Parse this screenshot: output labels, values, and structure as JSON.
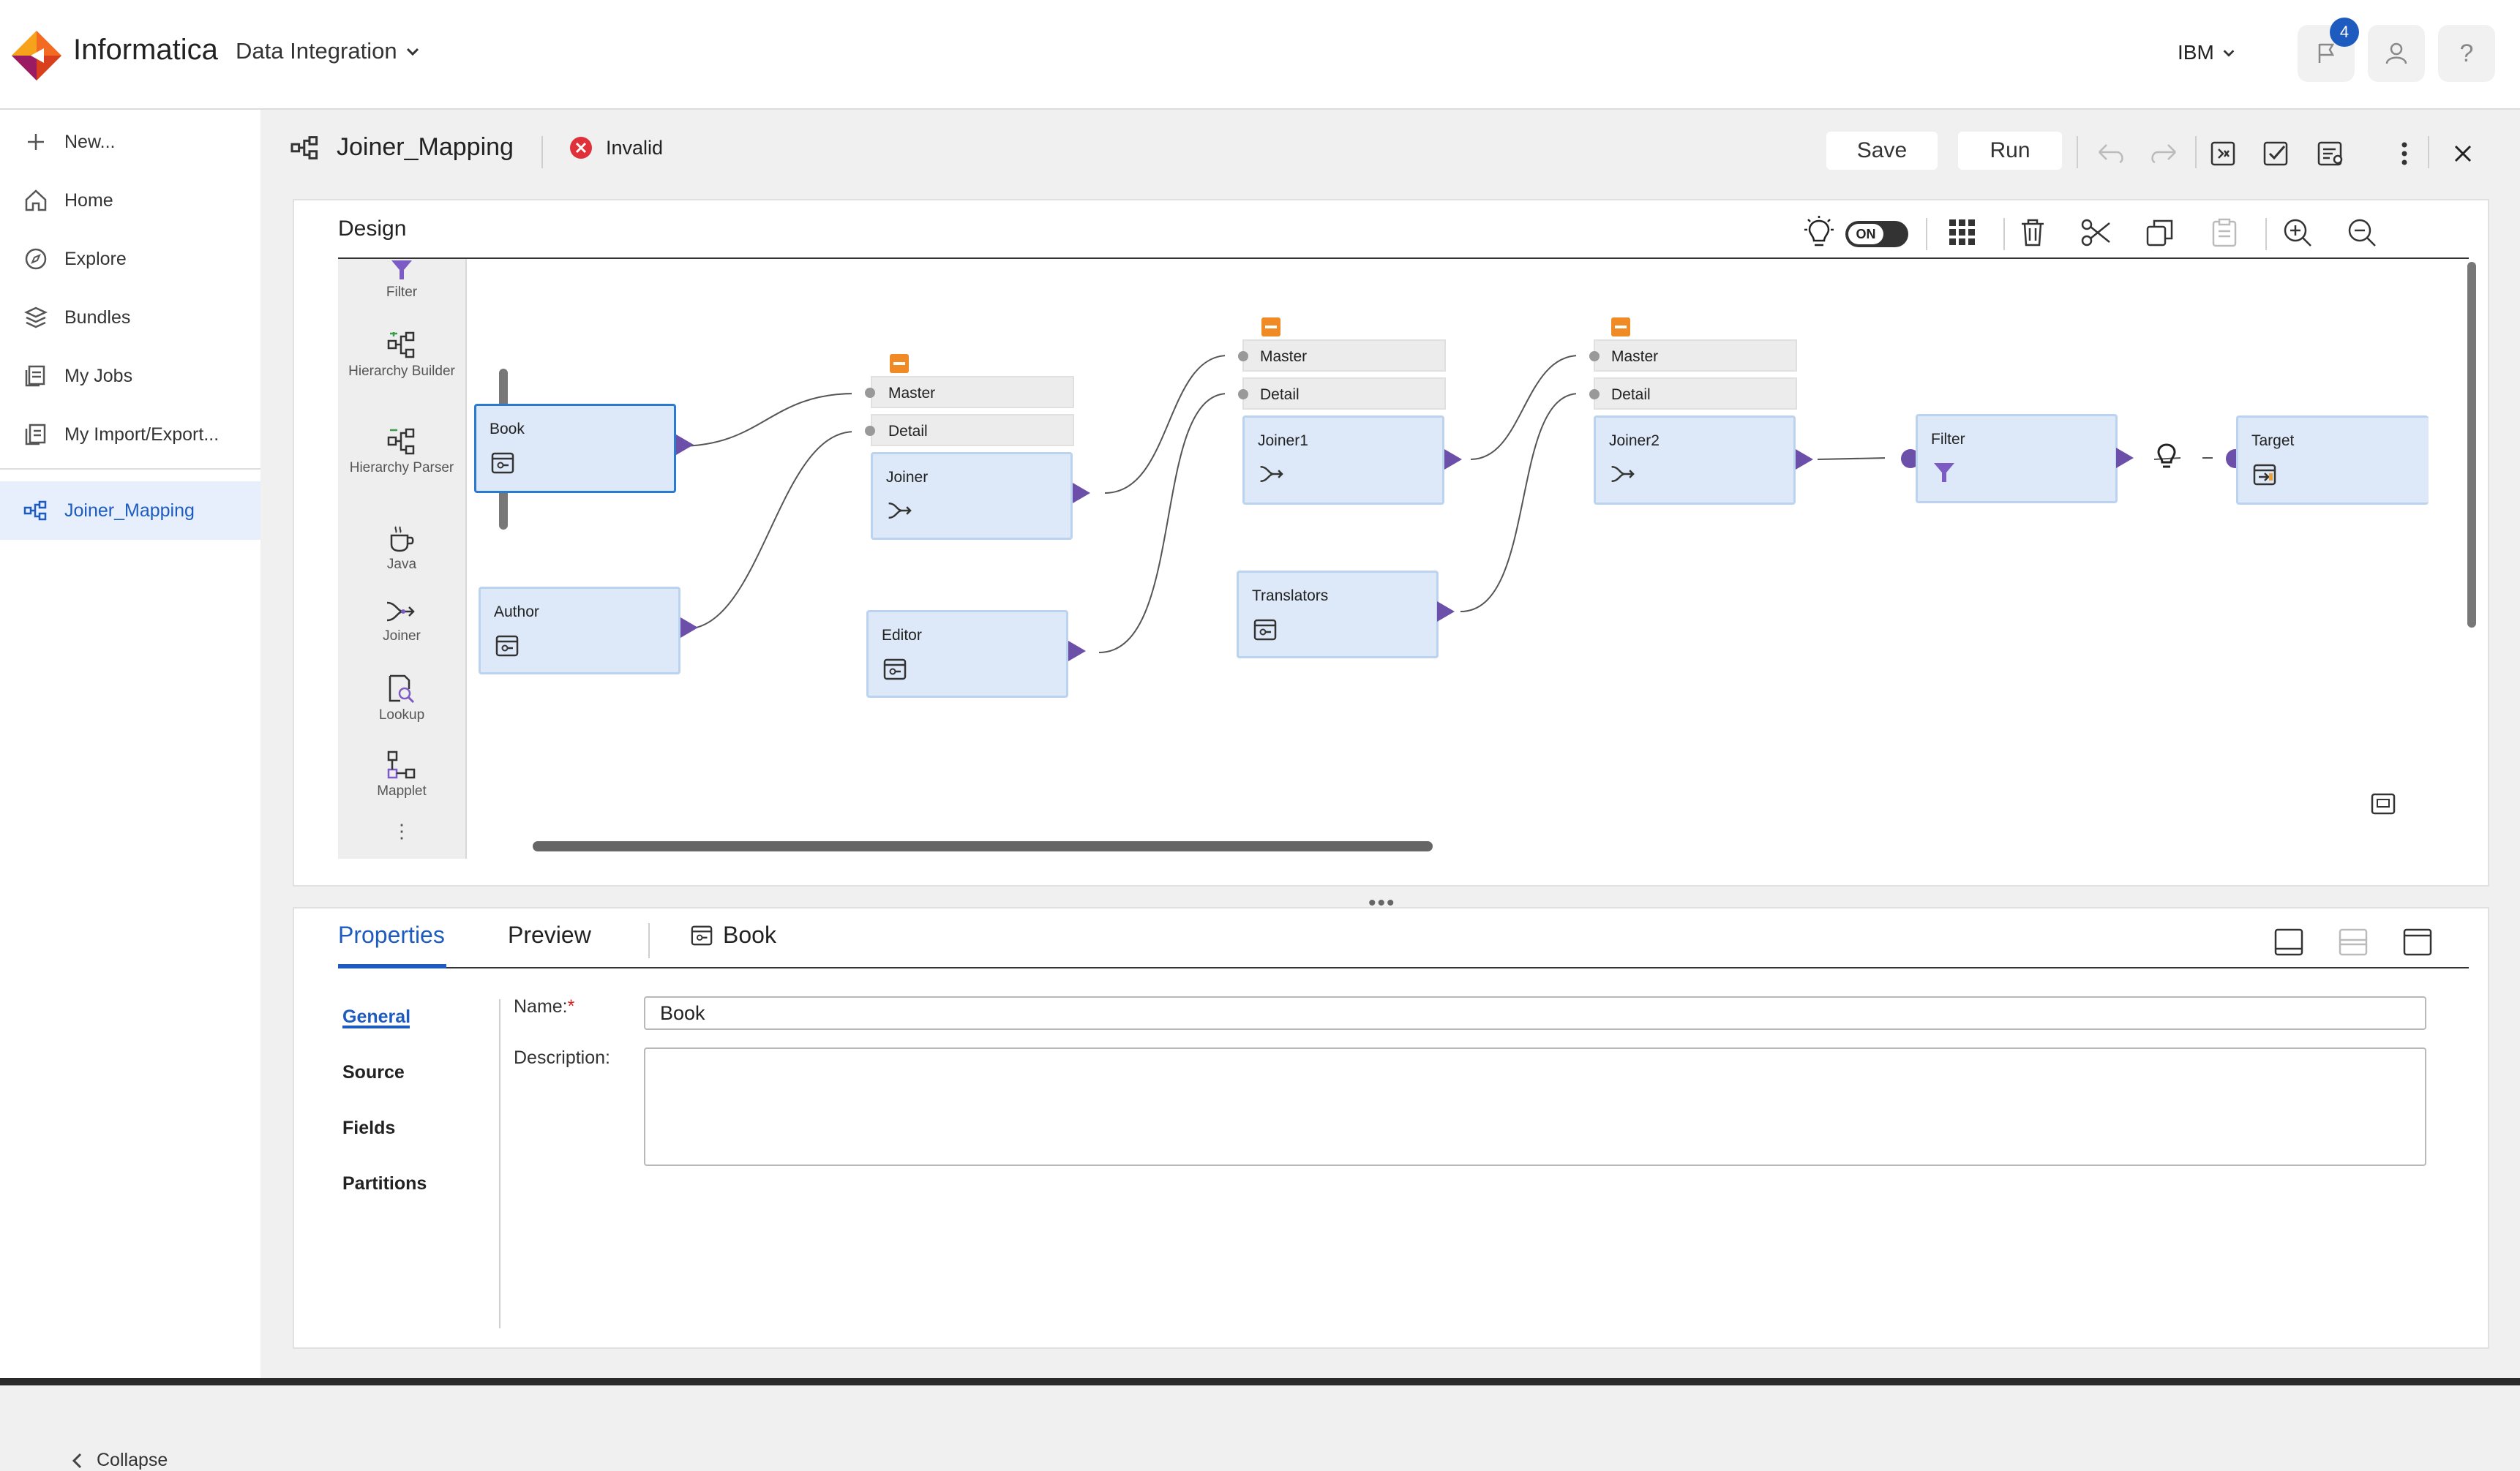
{
  "app": {
    "brand": "Informatica",
    "product": "Data Integration",
    "org": "IBM",
    "notification_count": "4",
    "help_glyph": "?"
  },
  "nav": {
    "new_label": "New...",
    "items": [
      {
        "label": "Home",
        "icon": "home-icon"
      },
      {
        "label": "Explore",
        "icon": "compass-icon"
      },
      {
        "label": "Bundles",
        "icon": "cube-stack-icon"
      },
      {
        "label": "My Jobs",
        "icon": "jobs-icon"
      },
      {
        "label": "My Import/Export...",
        "icon": "import-export-icon"
      }
    ],
    "open_asset": "Joiner_Mapping",
    "collapse_label": "Collapse"
  },
  "header": {
    "title": "Joiner_Mapping",
    "status": "Invalid",
    "save_label": "Save",
    "run_label": "Run"
  },
  "design": {
    "title": "Design",
    "toggle_label": "ON",
    "palette": [
      {
        "label": "Filter"
      },
      {
        "label": "Hierarchy Builder"
      },
      {
        "label": "Hierarchy Parser"
      },
      {
        "label": "Java"
      },
      {
        "label": "Joiner"
      },
      {
        "label": "Lookup"
      },
      {
        "label": "Mapplet"
      }
    ],
    "more_glyph": "⋮",
    "nodes": {
      "book": "Book",
      "author": "Author",
      "editor": "Editor",
      "translators": "Translators",
      "joiner": "Joiner",
      "joiner1": "Joiner1",
      "joiner2": "Joiner2",
      "filter": "Filter",
      "target": "Target"
    },
    "groups": {
      "master": "Master",
      "detail": "Detail"
    }
  },
  "properties": {
    "tabs": [
      "Properties",
      "Preview"
    ],
    "selected_object": "Book",
    "splitter_glyph": "•••",
    "sections": [
      "General",
      "Source",
      "Fields",
      "Partitions"
    ],
    "name_label": "Name:",
    "required_mark": "*",
    "name_value": "Book",
    "description_label": "Description:"
  },
  "colors": {
    "accent": "#1d5bbf",
    "node_fill": "#dde9f8",
    "port": "#6b4fa8",
    "collapse": "#f08a24",
    "invalid": "#e0303a"
  }
}
